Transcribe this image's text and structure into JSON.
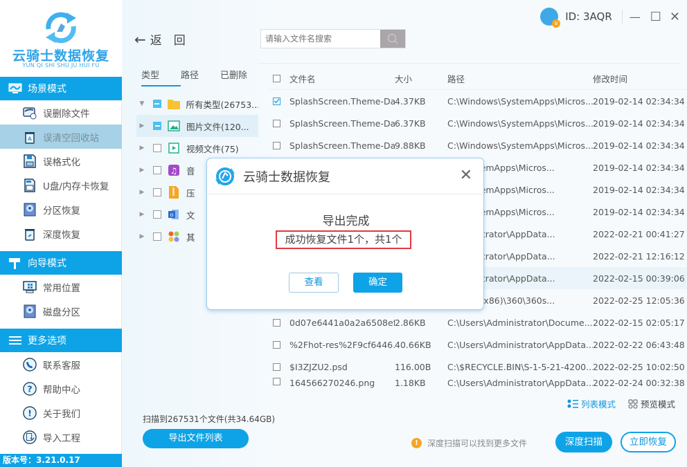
{
  "app": {
    "name": "云骑士数据恢复",
    "name_pinyin": "YUN QI SHI SHU JU HUI FU",
    "user_id": "ID: 3AQR",
    "version": "版本号：3.21.0.17",
    "accent": "#0ea3e6"
  },
  "window_controls": {
    "minimize": "—",
    "maximize": "☐",
    "close": "✕"
  },
  "sidebar": {
    "sections": [
      {
        "title": "场景模式",
        "items": [
          {
            "label": "误删除文件",
            "icon": "deleted-file-icon"
          },
          {
            "label": "误清空回收站",
            "icon": "recycle-bin-icon",
            "active": true
          },
          {
            "label": "误格式化",
            "icon": "floppy-disk-icon"
          },
          {
            "label": "U盘/内存卡恢复",
            "icon": "sd-card-icon"
          },
          {
            "label": "分区恢复",
            "icon": "partition-disk-icon"
          },
          {
            "label": "深度恢复",
            "icon": "deep-restore-bin-icon"
          }
        ]
      },
      {
        "title": "向导模式",
        "items": [
          {
            "label": "常用位置",
            "icon": "windows-monitor-icon"
          },
          {
            "label": "磁盘分区",
            "icon": "disk-partition-icon"
          }
        ]
      },
      {
        "title": "更多选项",
        "items": [
          {
            "label": "联系客服",
            "icon": "phone-icon"
          },
          {
            "label": "帮助中心",
            "icon": "help-icon"
          },
          {
            "label": "关于我们",
            "icon": "info-icon"
          },
          {
            "label": "导入工程",
            "icon": "import-icon"
          }
        ]
      }
    ]
  },
  "toolbar": {
    "back_label": "返　回",
    "search_placeholder": "请输入文件名搜索"
  },
  "filter_tabs": [
    {
      "label": "类型",
      "active": true
    },
    {
      "label": "路径"
    },
    {
      "label": "已删除"
    }
  ],
  "tree": [
    {
      "label": "所有类型(26753...",
      "state": "partial",
      "expanded": true,
      "icon": "folder-icon"
    },
    {
      "label": "图片文件(120...",
      "state": "partial",
      "icon": "image-icon",
      "selected": true
    },
    {
      "label": "视频文件(75)",
      "state": "unchecked",
      "icon": "video-icon"
    },
    {
      "label": "音",
      "state": "unchecked",
      "icon": "music-icon"
    },
    {
      "label": "压",
      "state": "unchecked",
      "icon": "archive-icon"
    },
    {
      "label": "文",
      "state": "unchecked",
      "icon": "document-icon"
    },
    {
      "label": "其",
      "state": "unchecked",
      "icon": "other-icon"
    }
  ],
  "table": {
    "headers": {
      "name": "文件名",
      "size": "大小",
      "path": "路径",
      "time": "修改时间"
    },
    "rows": [
      {
        "checked": true,
        "name": "SplashScreen.Theme-Da...",
        "size": "4.37KB",
        "path": "C:\\Windows\\SystemApps\\Micros...",
        "time": "2019-02-14 02:34:34"
      },
      {
        "checked": false,
        "name": "SplashScreen.Theme-Da...",
        "size": "6.37KB",
        "path": "C:\\Windows\\SystemApps\\Micros...",
        "time": "2019-02-14 02:34:34"
      },
      {
        "checked": false,
        "name": "SplashScreen.Theme-Da...",
        "size": "9.88KB",
        "path": "C:\\Windows\\SystemApps\\Micros...",
        "time": "2019-02-14 02:34:34"
      },
      {
        "checked": false,
        "name": "",
        "size": "",
        "path": "ws\\SystemApps\\Micros...",
        "time": "2019-02-14 02:34:34"
      },
      {
        "checked": false,
        "name": "",
        "size": "",
        "path": "ws\\SystemApps\\Micros...",
        "time": "2019-02-14 02:34:34"
      },
      {
        "checked": false,
        "name": "",
        "size": "",
        "path": "ws\\SystemApps\\Micros...",
        "time": "2019-02-14 02:34:34"
      },
      {
        "checked": false,
        "name": "",
        "size": "",
        "path": "Administrator\\AppData...",
        "time": "2022-02-21 00:41:27"
      },
      {
        "checked": false,
        "name": "",
        "size": "",
        "path": "Administrator\\AppData...",
        "time": "2022-02-21 12:16:12"
      },
      {
        "checked": false,
        "name": "",
        "size": "",
        "path": "Administrator\\AppData...",
        "time": "2022-02-15 00:39:06",
        "highlight": true
      },
      {
        "checked": false,
        "name": "",
        "size": "",
        "path": "m Files (x86)\\360\\360s...",
        "time": "2022-02-25 12:05:36"
      },
      {
        "checked": false,
        "name": "0d07e6441a0a2a6508ef...",
        "size": "2.86KB",
        "path": "C:\\Users\\Administrator\\Docume...",
        "time": "2022-02-15 02:05:17"
      },
      {
        "checked": false,
        "name": "%2Fhot-res%2F9cf6446...",
        "size": "40.66KB",
        "path": "C:\\Users\\Administrator\\AppData...",
        "time": "2022-02-22 06:43:48"
      },
      {
        "checked": false,
        "name": "$I3ZJZU2.psd",
        "size": "116.00B",
        "path": "C:\\$RECYCLE.BIN\\S-1-5-21-4200...",
        "time": "2022-02-25 10:02:50"
      },
      {
        "checked": false,
        "name": "164566270246.png",
        "size": "1.18KB",
        "path": "C:\\Users\\Administrator\\AppData...",
        "time": "2022-02-24 00:32:38"
      }
    ]
  },
  "footer": {
    "scan_status": "扫描到267531个文件(共34.64GB)",
    "export_list": "导出文件列表",
    "list_mode": "列表模式",
    "preview_mode": "预览模式",
    "hint": "深度扫描可以找到更多文件",
    "deep_scan": "深度扫描",
    "recover_now": "立即恢复"
  },
  "modal": {
    "title": "云骑士数据恢复",
    "close": "✕",
    "heading": "导出完成",
    "message": "成功恢复文件1个，共1个",
    "view_button": "查看",
    "ok_button": "确定"
  }
}
